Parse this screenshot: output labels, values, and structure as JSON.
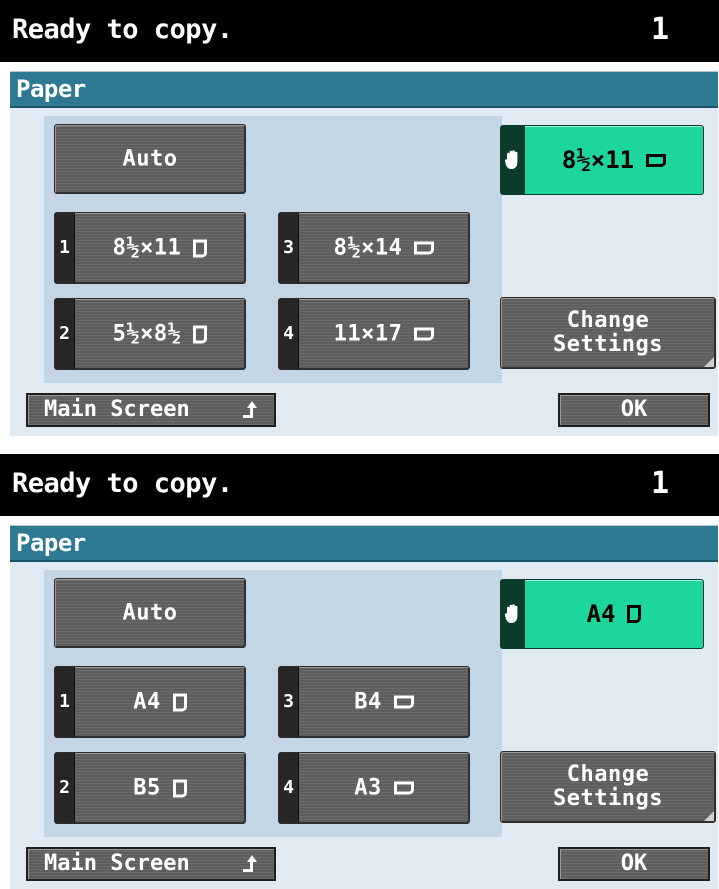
{
  "screens": [
    {
      "status": {
        "text": "Ready to copy.",
        "count": "1"
      },
      "panel_title": "Paper",
      "auto_label": "Auto",
      "bypass": {
        "label": "8½×11",
        "orientation": "landscape",
        "icon": "hand-icon"
      },
      "trays": [
        {
          "num": "1",
          "label": "8½×11",
          "orientation": "portrait"
        },
        {
          "num": "2",
          "label": "5½×8½",
          "orientation": "portrait"
        },
        {
          "num": "3",
          "label": "8½×14",
          "orientation": "landscape"
        },
        {
          "num": "4",
          "label": "11×17",
          "orientation": "landscape"
        }
      ],
      "change_settings": {
        "line1": "Change",
        "line2": "Settings"
      },
      "main_screen_label": "Main Screen",
      "ok_label": "OK"
    },
    {
      "status": {
        "text": "Ready to copy.",
        "count": "1"
      },
      "panel_title": "Paper",
      "auto_label": "Auto",
      "bypass": {
        "label": "A4",
        "orientation": "portrait",
        "icon": "hand-icon"
      },
      "trays": [
        {
          "num": "1",
          "label": "A4",
          "orientation": "portrait"
        },
        {
          "num": "2",
          "label": "B5",
          "orientation": "portrait"
        },
        {
          "num": "3",
          "label": "B4",
          "orientation": "landscape"
        },
        {
          "num": "4",
          "label": "A3",
          "orientation": "landscape"
        }
      ],
      "change_settings": {
        "line1": "Change",
        "line2": "Settings"
      },
      "main_screen_label": "Main Screen",
      "ok_label": "OK"
    }
  ],
  "colors": {
    "status_bar": "#000000",
    "title_bar": "#2f7891",
    "panel_bg": "#dfeaf2",
    "button_gray": "#636363",
    "selected_green": "#1cd69d"
  }
}
